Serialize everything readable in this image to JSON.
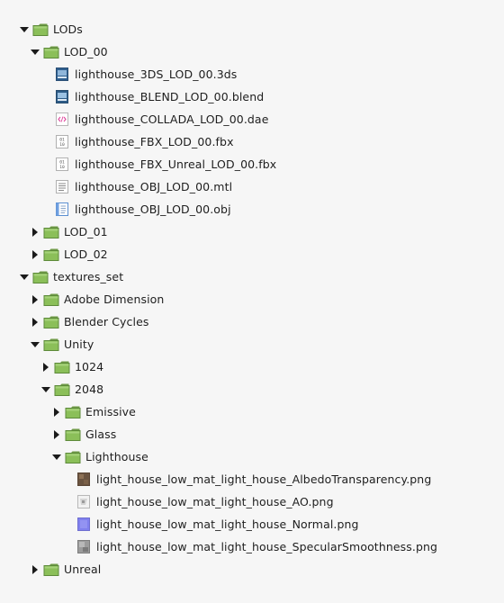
{
  "tree": [
    {
      "depth": 0,
      "type": "folder",
      "expanded": true,
      "label": "LODs"
    },
    {
      "depth": 1,
      "type": "folder",
      "expanded": true,
      "label": "LOD_00"
    },
    {
      "depth": 2,
      "type": "file",
      "icon": "3ds-file-icon",
      "label": "lighthouse_3DS_LOD_00.3ds"
    },
    {
      "depth": 2,
      "type": "file",
      "icon": "blend-file-icon",
      "label": "lighthouse_BLEND_LOD_00.blend"
    },
    {
      "depth": 2,
      "type": "file",
      "icon": "xml-code-file-icon",
      "label": "lighthouse_COLLADA_LOD_00.dae"
    },
    {
      "depth": 2,
      "type": "file",
      "icon": "binary-file-icon",
      "label": "lighthouse_FBX_LOD_00.fbx"
    },
    {
      "depth": 2,
      "type": "file",
      "icon": "binary-file-icon",
      "label": "lighthouse_FBX_Unreal_LOD_00.fbx"
    },
    {
      "depth": 2,
      "type": "file",
      "icon": "text-file-icon",
      "label": "lighthouse_OBJ_LOD_00.mtl"
    },
    {
      "depth": 2,
      "type": "file",
      "icon": "obj-file-icon",
      "label": "lighthouse_OBJ_LOD_00.obj"
    },
    {
      "depth": 1,
      "type": "folder",
      "expanded": false,
      "label": "LOD_01"
    },
    {
      "depth": 1,
      "type": "folder",
      "expanded": false,
      "label": "LOD_02"
    },
    {
      "depth": 0,
      "type": "folder",
      "expanded": true,
      "label": "textures_set"
    },
    {
      "depth": 1,
      "type": "folder",
      "expanded": false,
      "label": "Adobe Dimension"
    },
    {
      "depth": 1,
      "type": "folder",
      "expanded": false,
      "label": "Blender Cycles"
    },
    {
      "depth": 1,
      "type": "folder",
      "expanded": true,
      "label": "Unity"
    },
    {
      "depth": 2,
      "type": "folder",
      "expanded": false,
      "label": "1024"
    },
    {
      "depth": 2,
      "type": "folder",
      "expanded": true,
      "label": "2048"
    },
    {
      "depth": 3,
      "type": "folder",
      "expanded": false,
      "label": "Emissive"
    },
    {
      "depth": 3,
      "type": "folder",
      "expanded": false,
      "label": "Glass"
    },
    {
      "depth": 3,
      "type": "folder",
      "expanded": true,
      "label": "Lighthouse"
    },
    {
      "depth": 4,
      "type": "file",
      "icon": "albedo-texture-icon",
      "label": "light_house_low_mat_light_house_AlbedoTransparency.png"
    },
    {
      "depth": 4,
      "type": "file",
      "icon": "ao-texture-icon",
      "label": "light_house_low_mat_light_house_AO.png"
    },
    {
      "depth": 4,
      "type": "file",
      "icon": "normal-texture-icon",
      "label": "light_house_low_mat_light_house_Normal.png"
    },
    {
      "depth": 4,
      "type": "file",
      "icon": "specular-texture-icon",
      "label": "light_house_low_mat_light_house_SpecularSmoothness.png"
    },
    {
      "depth": 1,
      "type": "folder",
      "expanded": false,
      "label": "Unreal"
    }
  ]
}
